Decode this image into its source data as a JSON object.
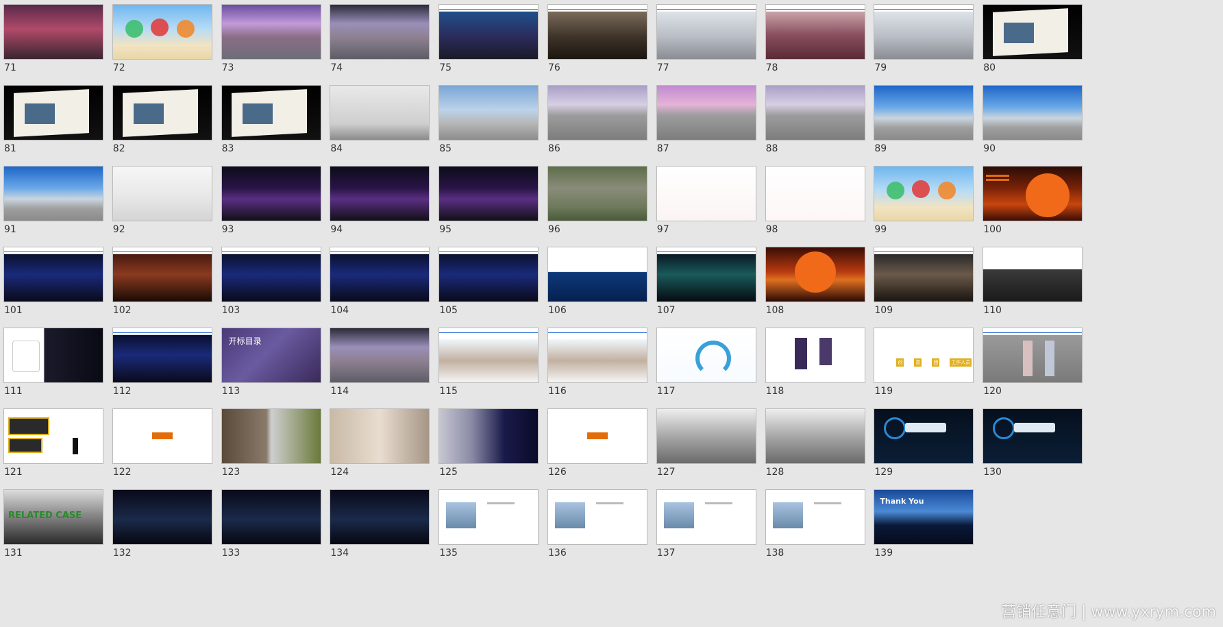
{
  "watermark": "营销任意门 | www.yxrym.com",
  "colors": {
    "background": "#e6e6e6",
    "thumb_border": "#b9b9b9",
    "slide_header_line": "#2a6fd6",
    "accent_orange": "#e36c0a"
  },
  "slides": [
    {
      "num": "71",
      "style": "crowd"
    },
    {
      "num": "72",
      "style": "beach-bubbles"
    },
    {
      "num": "73",
      "style": "town-purple"
    },
    {
      "num": "74",
      "style": "town-stage"
    },
    {
      "num": "75",
      "style": "stage-blue"
    },
    {
      "num": "76",
      "style": "photo-arch"
    },
    {
      "num": "77",
      "style": "building-pale"
    },
    {
      "num": "78",
      "style": "balloon-hall"
    },
    {
      "num": "79",
      "style": "building-pale"
    },
    {
      "num": "80",
      "style": "dark-card"
    },
    {
      "num": "81",
      "style": "dark-card"
    },
    {
      "num": "82",
      "style": "dark-card"
    },
    {
      "num": "83",
      "style": "dark-card"
    },
    {
      "num": "84",
      "style": "wall-icons"
    },
    {
      "num": "85",
      "style": "stage-city"
    },
    {
      "num": "86",
      "style": "stage-grey"
    },
    {
      "num": "87",
      "style": "stage-pink"
    },
    {
      "num": "88",
      "style": "stage-grey"
    },
    {
      "num": "89",
      "style": "sky-redcarpet"
    },
    {
      "num": "90",
      "style": "sky-redcarpet"
    },
    {
      "num": "91",
      "style": "sky-redcarpet"
    },
    {
      "num": "92",
      "style": "lounge-white"
    },
    {
      "num": "93",
      "style": "night-stage"
    },
    {
      "num": "94",
      "style": "night-stage"
    },
    {
      "num": "95",
      "style": "night-stage"
    },
    {
      "num": "96",
      "style": "aerial"
    },
    {
      "num": "97",
      "style": "grid-elevation"
    },
    {
      "num": "98",
      "style": "floorplan"
    },
    {
      "num": "99",
      "style": "beach-bubbles"
    },
    {
      "num": "100",
      "style": "sunset-list"
    },
    {
      "num": "101",
      "style": "laser-blue"
    },
    {
      "num": "102",
      "style": "dj"
    },
    {
      "num": "103",
      "style": "laser-blue"
    },
    {
      "num": "104",
      "style": "laser-blue"
    },
    {
      "num": "105",
      "style": "laser-blue"
    },
    {
      "num": "106",
      "style": "dance-blue"
    },
    {
      "num": "107",
      "style": "laser-green"
    },
    {
      "num": "108",
      "style": "sunset"
    },
    {
      "num": "109",
      "style": "band"
    },
    {
      "num": "110",
      "style": "car"
    },
    {
      "num": "111",
      "style": "tshirt"
    },
    {
      "num": "112",
      "style": "laser-blue"
    },
    {
      "num": "113",
      "style": "contents",
      "title": "开标目录"
    },
    {
      "num": "114",
      "style": "town-stage"
    },
    {
      "num": "115",
      "style": "facade"
    },
    {
      "num": "116",
      "style": "facade"
    },
    {
      "num": "117",
      "style": "plan-arc"
    },
    {
      "num": "118",
      "style": "banners"
    },
    {
      "num": "119",
      "style": "posters",
      "labels": [
        "创",
        "意",
        "团",
        "工作人员"
      ]
    },
    {
      "num": "120",
      "style": "rollup"
    },
    {
      "num": "121",
      "style": "badges"
    },
    {
      "num": "122",
      "style": "blank-tag"
    },
    {
      "num": "123",
      "style": "models"
    },
    {
      "num": "124",
      "style": "gowns"
    },
    {
      "num": "125",
      "style": "blue-dress"
    },
    {
      "num": "126",
      "style": "blank-tag"
    },
    {
      "num": "127",
      "style": "team"
    },
    {
      "num": "128",
      "style": "team"
    },
    {
      "num": "129",
      "style": "blue-flow"
    },
    {
      "num": "130",
      "style": "blue-flow"
    },
    {
      "num": "131",
      "style": "related",
      "title": "RELATED CASE"
    },
    {
      "num": "132",
      "style": "case-photo"
    },
    {
      "num": "133",
      "style": "case-photo"
    },
    {
      "num": "134",
      "style": "case-photo"
    },
    {
      "num": "135",
      "style": "white-photo"
    },
    {
      "num": "136",
      "style": "white-photo"
    },
    {
      "num": "137",
      "style": "white-photo"
    },
    {
      "num": "138",
      "style": "white-photo"
    },
    {
      "num": "139",
      "style": "thankyou",
      "title": "Thank You"
    }
  ]
}
